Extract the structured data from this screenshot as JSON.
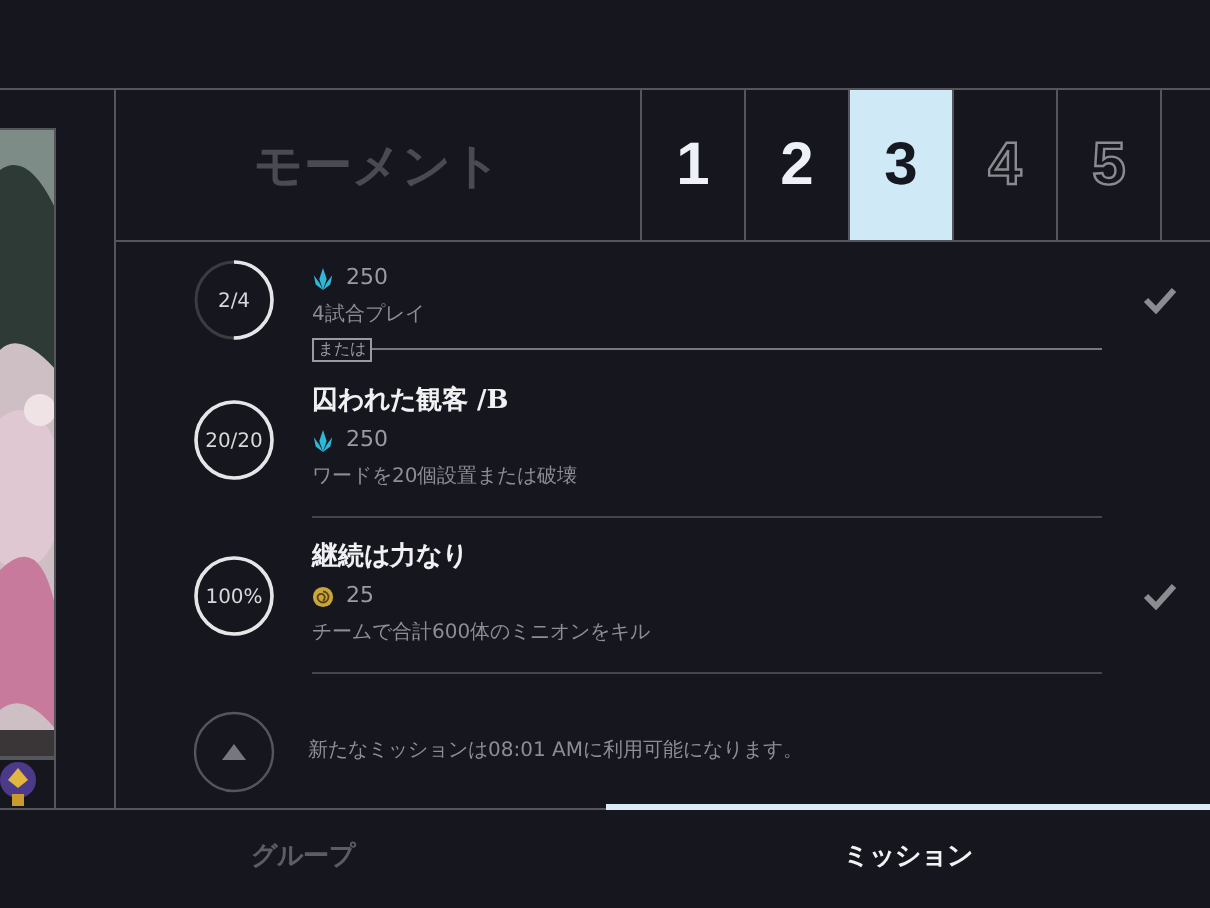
{
  "header": {
    "title": "モーメント"
  },
  "stage_tabs": [
    {
      "label": "1",
      "selected": false,
      "available": true
    },
    {
      "label": "2",
      "selected": false,
      "available": true
    },
    {
      "label": "3",
      "selected": true,
      "available": true
    },
    {
      "label": "4",
      "selected": false,
      "available": false
    },
    {
      "label": "5",
      "selected": false,
      "available": false
    }
  ],
  "missions": [
    {
      "progress": "2/4",
      "level": 0.5,
      "reward": {
        "kind": "crystal",
        "amount": "250"
      },
      "description": "4試合プレイ",
      "completed": true,
      "separator": "または"
    },
    {
      "progress": "20/20",
      "level": 1,
      "title": "囚われた観客 /B",
      "reward": {
        "kind": "crystal",
        "amount": "250"
      },
      "description": "ワードを20個設置または破壊",
      "completed": false
    },
    {
      "progress": "100%",
      "level": 1,
      "title": "継続は力なり",
      "reward": {
        "kind": "coin",
        "amount": "25"
      },
      "description": "チームで合計600体のミニオンをキル",
      "completed": true
    }
  ],
  "next_mission": {
    "note": "新たなミッションは08:01 AMに利用可能になります。"
  },
  "bottom_tabs": [
    {
      "label": "グループ",
      "selected": false
    },
    {
      "label": "ミッション",
      "selected": true
    }
  ]
}
